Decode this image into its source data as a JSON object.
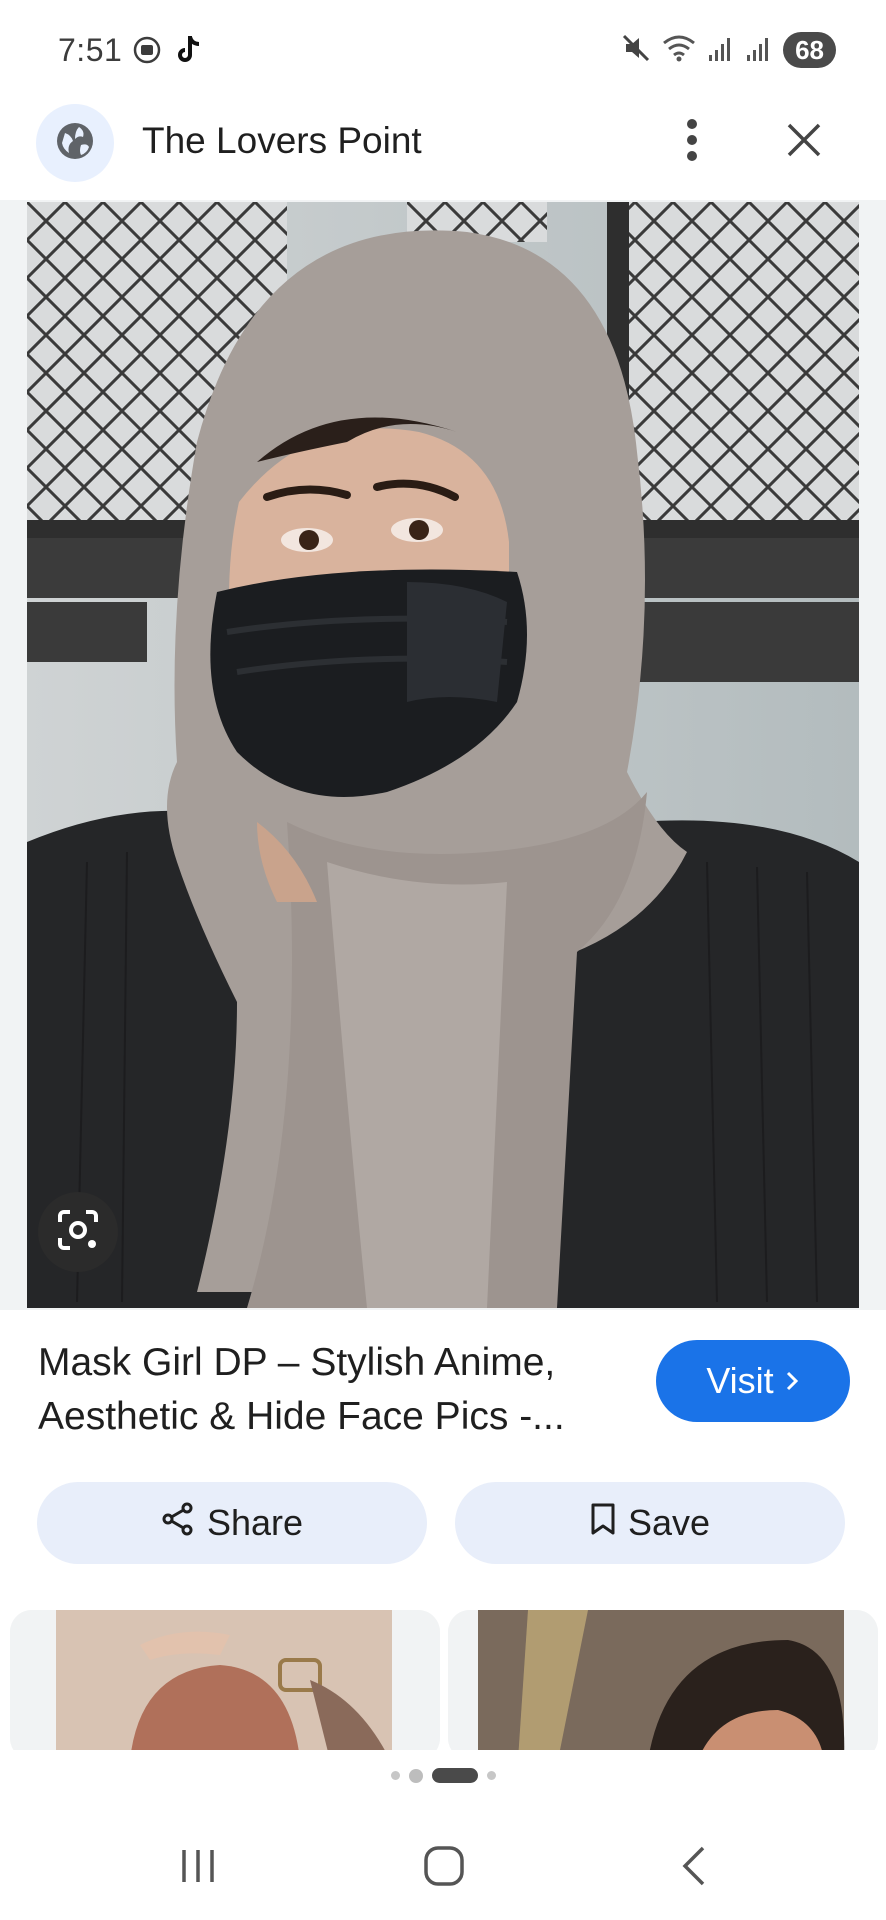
{
  "status_bar": {
    "time": "7:51",
    "battery": "68",
    "left_icons": [
      "screen-record-icon",
      "tiktok-icon"
    ],
    "right_icons": [
      "mute-icon",
      "wifi-icon",
      "signal-icon",
      "signal-icon"
    ]
  },
  "header": {
    "site_name": "The Lovers Point",
    "site_icon": "globe-icon",
    "more_icon": "more-vert-icon",
    "close_icon": "close-icon"
  },
  "image": {
    "lens_icon": "google-lens-icon"
  },
  "result": {
    "caption": "Mask Girl DP – Stylish Anime, Aesthetic & Hide Face Pics -...",
    "visit_label": "Visit",
    "share_label": "Share",
    "save_label": "Save"
  },
  "pager": {
    "dots": 4,
    "active_index": 2
  },
  "navbar": {
    "recents_icon": "recents-icon",
    "home_icon": "home-icon",
    "back_icon": "back-icon"
  },
  "colors": {
    "accent": "#1a73e8",
    "action_bg": "#e8eefa",
    "avatar_bg": "#e8f0fe"
  }
}
